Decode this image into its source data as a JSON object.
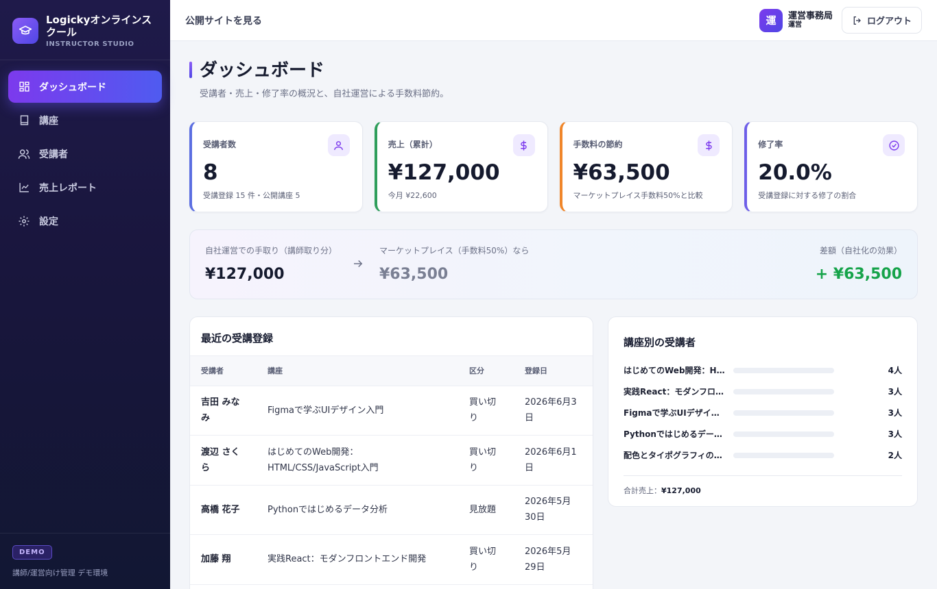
{
  "brand": {
    "name": "Logickyオンラインスクール",
    "sub": "INSTRUCTOR STUDIO"
  },
  "nav": [
    {
      "label": "ダッシュボード",
      "icon": "dashboard-icon"
    },
    {
      "label": "講座",
      "icon": "book-icon"
    },
    {
      "label": "受講者",
      "icon": "users-icon"
    },
    {
      "label": "売上レポート",
      "icon": "chart-line-icon"
    },
    {
      "label": "設定",
      "icon": "gear-icon"
    }
  ],
  "sidebar_footer": {
    "badge": "DEMO",
    "text": "講師/運営向け管理 デモ環境"
  },
  "topbar": {
    "public_link": "公開サイトを見る",
    "avatar_char": "運",
    "user_name": "運営事務局",
    "user_role": "運営",
    "logout": "ログアウト"
  },
  "page": {
    "title": "ダッシュボード",
    "subtitle": "受講者・売上・修了率の概況と、自社運営による手数料節約。"
  },
  "stats": [
    {
      "label": "受講者数",
      "value": "8",
      "note": "受講登録 15 件・公開講座 5",
      "accent": "#5b6ee1",
      "icon": "user-icon"
    },
    {
      "label": "売上（累計）",
      "value": "¥127,000",
      "note": "今月 ¥22,600",
      "accent": "#2f9e5b",
      "icon": "dollar-icon"
    },
    {
      "label": "手数料の節約",
      "value": "¥63,500",
      "note": "マーケットプレイス手数料50%と比較",
      "accent": "#f0862a",
      "icon": "dollar-icon"
    },
    {
      "label": "修了率",
      "value": "20.0%",
      "note": "受講登録に対する修了の割合",
      "accent": "#6d5ee8",
      "icon": "check-circle-icon"
    }
  ],
  "compare": {
    "own_label": "自社運営での手取り（講師取り分）",
    "own_value": "¥127,000",
    "market_label": "マーケットプレイス（手数料50%）なら",
    "market_value": "¥63,500",
    "diff_label": "差額（自社化の効果）",
    "diff_value": "+ ¥63,500",
    "diff_color": "#16a34a"
  },
  "enrollments": {
    "title": "最近の受講登録",
    "columns": [
      "受講者",
      "講座",
      "区分",
      "登録日"
    ],
    "rows": [
      {
        "student": "吉田 みなみ",
        "course": "Figmaで学ぶUIデザイン入門",
        "type": "買い切り",
        "date": "2026年6月3日"
      },
      {
        "student": "渡辺 さくら",
        "course": "はじめてのWeb開発：HTML/CSS/JavaScript入門",
        "type": "買い切り",
        "date": "2026年6月1日"
      },
      {
        "student": "高橋 花子",
        "course": "Pythonではじめるデータ分析",
        "type": "見放題",
        "date": "2026年5月30日"
      },
      {
        "student": "加藤 翔",
        "course": "実践React：モダンフロントエンド開発",
        "type": "買い切り",
        "date": "2026年5月29日"
      }
    ]
  },
  "by_course": {
    "title": "講座別の受講者",
    "items": [
      {
        "name": "はじめてのWeb開発：HTML/CSS/JavaScript入門",
        "count": "4人",
        "fill": 0
      },
      {
        "name": "実践React：モダンフロントエンド開発",
        "count": "3人",
        "fill": 0
      },
      {
        "name": "Figmaで学ぶUIデザイン入門",
        "count": "3人",
        "fill": 0
      },
      {
        "name": "Pythonではじめるデータ分析",
        "count": "3人",
        "fill": 0
      },
      {
        "name": "配色とタイポグラフィの基礎",
        "count": "2人",
        "fill": 0
      }
    ],
    "total_label": "合計売上：",
    "total_value": "¥127,000"
  }
}
